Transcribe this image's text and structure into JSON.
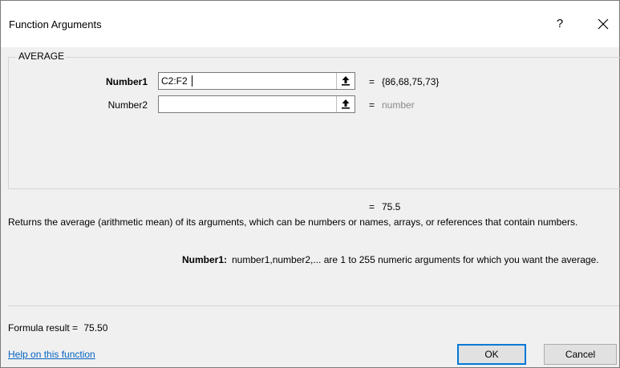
{
  "window": {
    "title": "Function Arguments",
    "help_label": "?"
  },
  "function": {
    "name": "AVERAGE"
  },
  "arguments": [
    {
      "label": "Number1",
      "value": "C2:F2",
      "evaluated": "{86,68,75,73}",
      "bold": true
    },
    {
      "label": "Number2",
      "value": "",
      "evaluated": "number",
      "bold": false
    }
  ],
  "equals_sign": "=",
  "result": {
    "value": "75.5"
  },
  "description": "Returns the average (arithmetic mean) of its arguments, which can be numbers or names, arrays, or references that contain numbers.",
  "arg_help": {
    "name": "Number1:",
    "text": "number1,number2,... are 1 to 255 numeric arguments for which you want the average."
  },
  "formula_result": {
    "label": "Formula result =",
    "value": "75.50"
  },
  "footer": {
    "help_link": "Help on this function",
    "ok_label": "OK",
    "cancel_label": "Cancel"
  },
  "colors": {
    "link": "#0563c1",
    "ok_border": "#0078d7",
    "placeholder_text": "#8a8a8a"
  },
  "icons": [
    "close-icon",
    "ref-collapse-icon"
  ]
}
